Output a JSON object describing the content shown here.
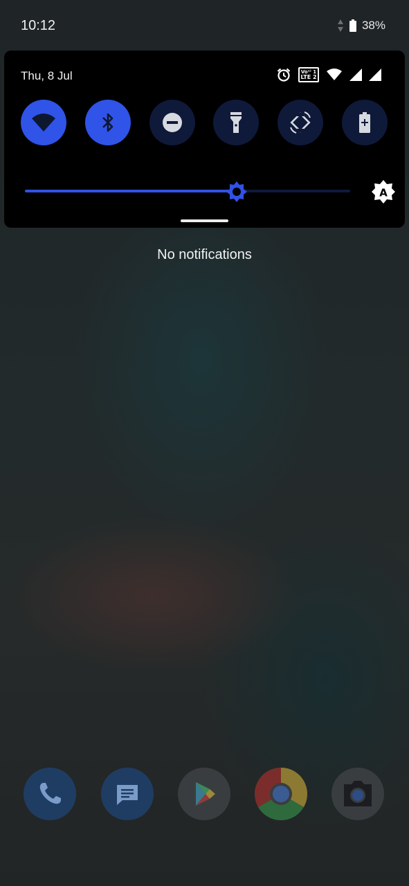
{
  "status_bar": {
    "time": "10:12",
    "battery_percent": "38%",
    "icons": [
      "data-activity-icon",
      "battery-icon"
    ]
  },
  "quick_settings": {
    "date": "Thu, 8 Jul",
    "status_icons": [
      "alarm-icon",
      "volte-icon",
      "wifi-signal-icon",
      "cell-signal-icon",
      "cell-signal-icon"
    ],
    "volte": {
      "line1": "Vo¹⁾ 1",
      "line2": "LTE 2"
    },
    "tiles": [
      {
        "icon": "wifi-icon",
        "state": "on"
      },
      {
        "icon": "bluetooth-icon",
        "state": "on"
      },
      {
        "icon": "do-not-disturb-icon",
        "state": "off"
      },
      {
        "icon": "flashlight-icon",
        "state": "off"
      },
      {
        "icon": "auto-rotate-icon",
        "state": "off"
      },
      {
        "icon": "battery-saver-icon",
        "state": "off"
      }
    ],
    "brightness": {
      "level": 0.65,
      "auto_icon": "auto-brightness-icon",
      "auto_label": "A"
    }
  },
  "notifications": {
    "empty_text": "No notifications"
  },
  "dock": {
    "apps": [
      "phone-icon",
      "messages-icon",
      "play-store-icon",
      "chrome-icon",
      "camera-icon"
    ]
  },
  "colors": {
    "accent_on": "#3053e8",
    "tile_off": "#0f1a3a",
    "panel": "#000000"
  }
}
